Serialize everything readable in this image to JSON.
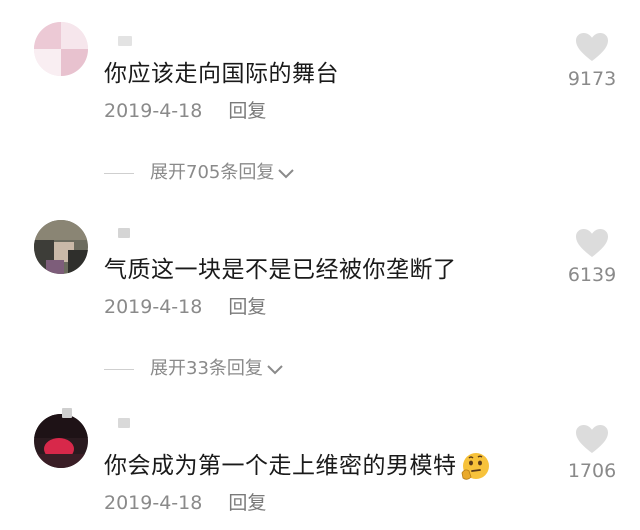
{
  "comments": [
    {
      "text": "你应该走向国际的舞台",
      "date": "2019-4-18",
      "reply_label": "回复",
      "likes": "9173",
      "expand_label": "展开705条回复"
    },
    {
      "text": "气质这一块是不是已经被你垄断了",
      "date": "2019-4-18",
      "reply_label": "回复",
      "likes": "6139",
      "expand_label": "展开33条回复"
    },
    {
      "text": "你会成为第一个走上维密的男模特",
      "date": "2019-4-18",
      "reply_label": "回复",
      "likes": "1706",
      "emoji": "thinking-emoji"
    }
  ],
  "colors": {
    "text": "#1a1a1a",
    "meta": "#8a8a8a",
    "like_icon": "#dcdcdc"
  }
}
